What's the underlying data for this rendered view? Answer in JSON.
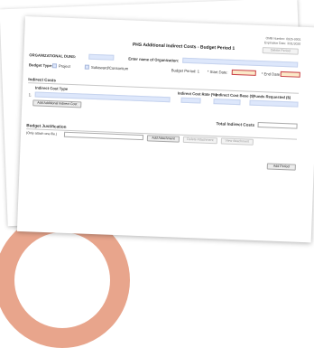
{
  "header": {
    "omb_number": "OMB Number: 0925-0001",
    "expiration": "Expiration Date: 3/31/2020",
    "title": "PHS Additional Indirect Costs - Budget Period  1",
    "delete_period": "Delete Period"
  },
  "org": {
    "duns_label": "ORGANIZATIONAL DUNS:",
    "duns_value": "",
    "name_label": "Enter name of Organization:",
    "name_value": ""
  },
  "budget": {
    "type_label": "Budget Type:",
    "project_label": "Project",
    "subaward_label": "Subaward/Consortium",
    "period_label": "Budget Period:  1",
    "start_label": "* Start Date:",
    "start_value": "",
    "end_label": "* End Date:",
    "end_value": ""
  },
  "indirect": {
    "section_title": "Indirect Costs",
    "col_type": "Indirect Cost Type",
    "col_rate": "Indirect Cost  Rate (%)",
    "col_base": "Indirect Cost  Base ($)",
    "col_funds": "Funds Requested ($)",
    "row_number": "1.",
    "add_button": "Add Additional Indirect Cost",
    "total_label": "Total Indirect Costs",
    "total_value": ""
  },
  "justification": {
    "section_title": "Budget Justification",
    "hint": "(Only attach one file.)",
    "file_value": "",
    "add_attachment": "Add Attachment",
    "delete_attachment": "Delete Attachment",
    "view_attachment": "View Attachment"
  },
  "footer": {
    "add_period": "Add Period"
  }
}
